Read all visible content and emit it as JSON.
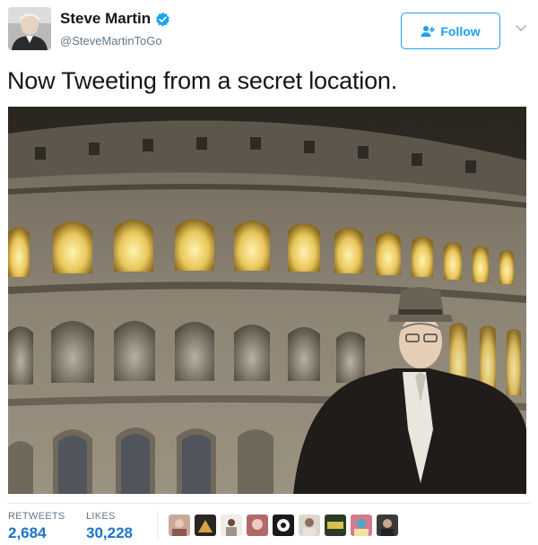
{
  "user": {
    "display_name": "Steve Martin",
    "handle": "@SteveMartinToGo",
    "avatar_icon": "person-avatar-icon",
    "verified_icon": "verified-badge-icon",
    "verified_color": "#1da1f2"
  },
  "header": {
    "follow_label": "Follow",
    "follow_icon": "add-person-icon",
    "menu_icon": "chevron-down-icon"
  },
  "tweet": {
    "text": "Now Tweeting from a secret location."
  },
  "media": {
    "photo_subject": "photo"
  },
  "stats": {
    "retweets_label": "RETWEETS",
    "retweets_value": "2,684",
    "likes_label": "LIKES",
    "likes_value": "30,228"
  },
  "likers": [
    {
      "icon": "liker-avatar-1"
    },
    {
      "icon": "liker-avatar-2"
    },
    {
      "icon": "liker-avatar-3"
    },
    {
      "icon": "liker-avatar-4"
    },
    {
      "icon": "liker-avatar-5"
    },
    {
      "icon": "liker-avatar-6"
    },
    {
      "icon": "liker-avatar-7"
    },
    {
      "icon": "liker-avatar-8"
    },
    {
      "icon": "liker-avatar-9"
    }
  ],
  "colors": {
    "accent": "#1da1f2",
    "stat_value": "#1a73c8",
    "muted": "#657786"
  }
}
